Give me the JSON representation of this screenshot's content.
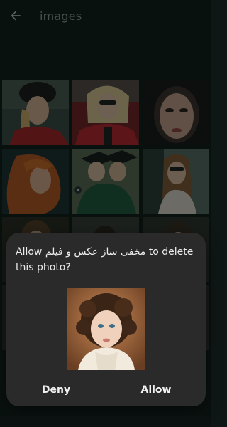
{
  "appbar": {
    "title": "images",
    "back_icon": "arrow-left-icon"
  },
  "dialog": {
    "message": "Allow مخفی ساز عکس و فیلم to delete this photo?",
    "deny_label": "Deny",
    "allow_label": "Allow"
  },
  "theme": {
    "background": "#0f1716",
    "dialog": "#2a2a2a",
    "text": "#ececec"
  }
}
